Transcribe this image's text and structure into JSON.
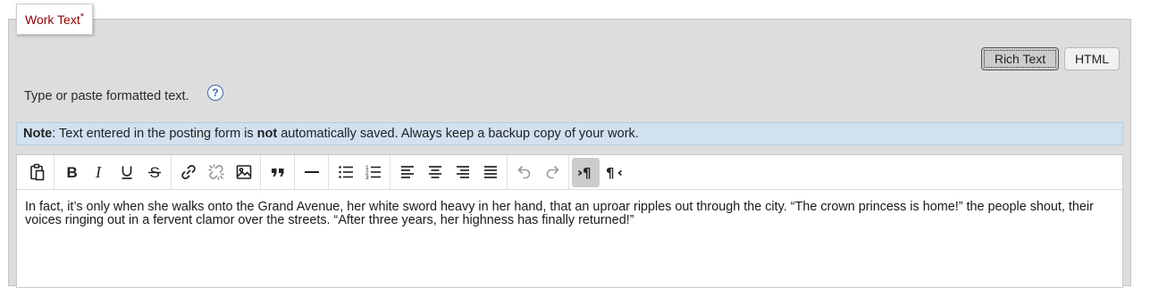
{
  "field": {
    "legend": "Work Text",
    "required_mark": "*",
    "hint": "Type or paste formatted text.",
    "help_icon": "question-circle"
  },
  "modes": {
    "rich_text": "Rich Text",
    "html": "HTML",
    "selected": "Rich Text"
  },
  "note": {
    "label": "Note",
    "text_before": ": Text entered in the posting form is ",
    "emphasis": "not",
    "text_after": " automatically saved. Always keep a backup copy of your work."
  },
  "toolbar": {
    "groups": [
      [
        "paste-icon"
      ],
      [
        "bold-icon",
        "italic-icon",
        "underline-icon",
        "strikethrough-icon"
      ],
      [
        "link-icon",
        "unlink-icon",
        "image-icon"
      ],
      [
        "blockquote-icon"
      ],
      [
        "horizontal-rule-icon"
      ],
      [
        "bullet-list-icon",
        "numbered-list-icon"
      ],
      [
        "align-left-icon",
        "align-center-icon",
        "align-right-icon",
        "align-justify-icon"
      ],
      [
        "undo-icon",
        "redo-icon"
      ],
      [
        "ltr-direction-icon",
        "rtl-direction-icon"
      ]
    ],
    "active": "ltr-direction-icon",
    "disabled": [
      "unlink-icon",
      "undo-icon",
      "redo-icon"
    ]
  },
  "editor": {
    "content": "In fact, it’s only when she walks onto the Grand Avenue, her white sword heavy in her hand, that an uproar ripples out through the city. “The crown princess is home!” the people shout, their voices ringing out in a fervent clamor over the streets. “After three years, her highness has finally returned!”"
  }
}
